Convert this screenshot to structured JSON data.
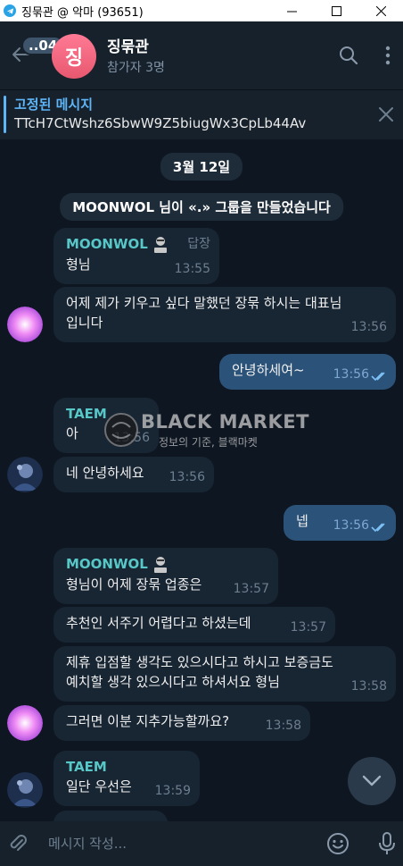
{
  "window": {
    "title": "징묶관 @ 악마 (93651)"
  },
  "header": {
    "back_unread_count": "..04",
    "avatar_letter": "징",
    "chat_title": "징묶관",
    "subtitle": "참가자 3명"
  },
  "pinned": {
    "label": "고정된 메시지",
    "text": "TTcH7CtWshz6SbwW9Z5biugWx3CpLb44Av"
  },
  "chat": {
    "date_label": "3월 12일",
    "service_message": "MOONWOL 님이 «.» 그룹을 만들었습니다",
    "watermark_title": "BLACK MARKET",
    "watermark_sub": "정보의 기준, 블랙마켓",
    "messages": [
      {
        "sender": "MOONWOL",
        "reply_label": "답장",
        "text": "형님",
        "time": "13:55"
      },
      {
        "text": "어제 제가 키우고 싶다 말했던 장묶 하시는 대표님 입니다",
        "line1": "어제 제가 키우고 싶다 말했던 장묶 하시는 대표님",
        "line2": "입니다",
        "time": "13:56"
      },
      {
        "text": "안녕하세여~",
        "time": "13:56"
      },
      {
        "sender": "TAEM",
        "text": "아",
        "time": "13:56"
      },
      {
        "text": "네 안녕하세요",
        "time": "13:56"
      },
      {
        "text": "넵",
        "time": "13:56"
      },
      {
        "sender": "MOONWOL",
        "text": "형님이 어제 장묶 업종은",
        "time": "13:57"
      },
      {
        "text": "추천인 서주기 어렵다고 하셨는데",
        "time": "13:57"
      },
      {
        "text": "제휴 입점할 생각도 있으시다고 하시고 보증금도 예치할 생각 있으시다고 하셔서요 형님",
        "line1": "제휴 입점할 생각도 있으시다고 하시고 보증금도",
        "line2": "예치할 생각 있으시다고 하셔서요 형님",
        "time": "13:58"
      },
      {
        "text": "그러면 이분 지추가능할까요?",
        "time": "13:58"
      },
      {
        "sender": "TAEM",
        "text": "일단 우선은",
        "time": "13:59"
      }
    ]
  },
  "composer": {
    "placeholder": "메시지 작성..."
  },
  "colors": {
    "background": "#0e1621",
    "header": "#17212b",
    "incoming_bubble": "#182533",
    "outgoing_bubble": "#2b5278",
    "accent": "#5eb5f7",
    "sender_name": "#58c7c7"
  }
}
